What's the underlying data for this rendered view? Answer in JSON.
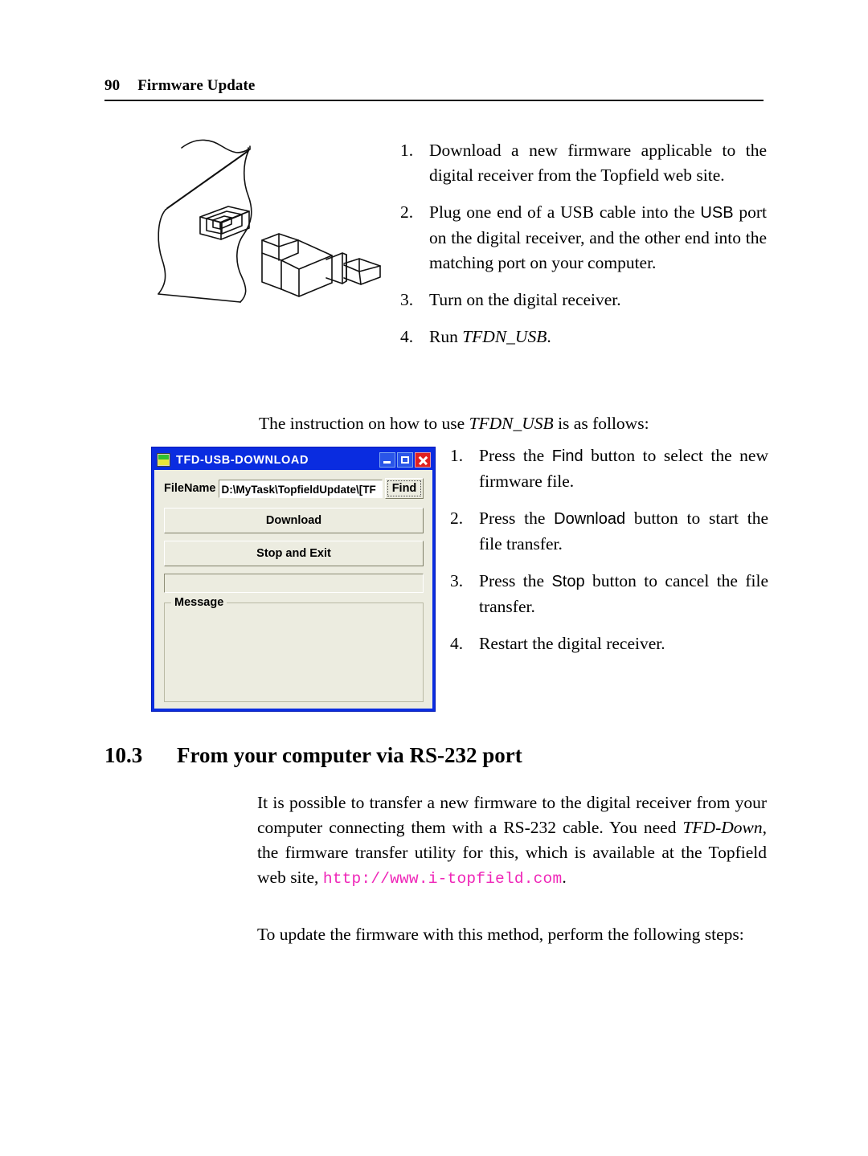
{
  "page": {
    "number": "90",
    "running_head": "Firmware Update"
  },
  "illustration": {
    "name": "usb-b-port-and-connector-line-drawing",
    "alt": "Line drawing of a USB type-B port on a receiver panel with a USB type-B cable connector"
  },
  "steps_top": [
    {
      "num": "1.",
      "text_a": "Download a new firmware applicable to the digital receiver from the Topfield web site."
    },
    {
      "num": "2.",
      "text_a": "Plug one end of a USB cable into the ",
      "ui": "USB",
      "text_b": " port on the digital receiver, and the other end into the matching port on your computer."
    },
    {
      "num": "3.",
      "text_a": "Turn on the digital receiver."
    },
    {
      "num": "4.",
      "text_a": "Run ",
      "ital": "TFDN_USB",
      "text_b": "."
    }
  ],
  "lead_line": {
    "text_a": "The instruction on how to use ",
    "ital": "TFDN_USB",
    "text_b": " is as follows:"
  },
  "dialog": {
    "title": "TFD-USB-DOWNLOAD",
    "app_icon": "tfd-app-icon",
    "window_buttons": {
      "minimize": "minimize-button",
      "maximize": "maximize-button",
      "close": "close-button"
    },
    "filename_label": "FileName",
    "filename_value": "D:\\MyTask\\TopfieldUpdate\\[TF",
    "find_button": "Find",
    "download_button": "Download",
    "stop_and_exit_button": "Stop and Exit",
    "progress_value": "",
    "message_group_label": "Message",
    "message_text": ""
  },
  "steps_bottom": [
    {
      "num": "1.",
      "text_a": "Press the ",
      "ui": "Find",
      "text_b": " button to select the new firmware file."
    },
    {
      "num": "2.",
      "text_a": "Press the ",
      "ui": "Download",
      "text_b": " button to start the file transfer."
    },
    {
      "num": "3.",
      "text_a": "Press the ",
      "ui": "Stop",
      "text_b": " button to cancel the file transfer."
    },
    {
      "num": "4.",
      "text_a": "Restart the digital receiver."
    }
  ],
  "section": {
    "number": "10.3",
    "title": "From your computer via RS-232 port"
  },
  "body_paragraph_1": {
    "text_a": "It is possible to transfer a new firmware to the digital receiver from your computer connecting them with a RS-232 cable. You need ",
    "ital": "TFD-Down",
    "text_b": ", the firmware transfer utility for this, which is available at the Topfield web site, ",
    "url": "http://www.i-topfield.com",
    "text_c": "."
  },
  "body_paragraph_2": {
    "text": "To update the firmware with this method, perform the following steps:"
  },
  "colors": {
    "titlebar_blue": "#0a2ce0",
    "dialog_face": "#ecece0",
    "close_red": "#e02020",
    "url_magenta": "#ef26b8",
    "text_black": "#000000"
  }
}
